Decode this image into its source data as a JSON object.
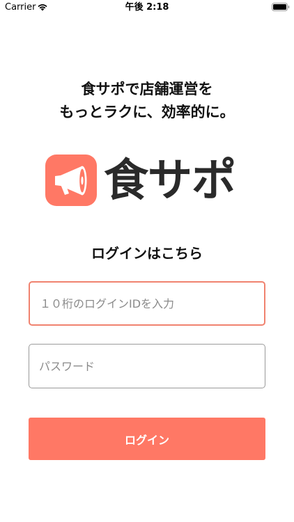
{
  "status_bar": {
    "carrier": "Carrier",
    "time": "午後 2:18"
  },
  "tagline": {
    "line1": "食サポで店舗運営を",
    "line2": "もっとラクに、効率的に。"
  },
  "logo": {
    "text": "食サポ",
    "icon": "megaphone-icon",
    "mark_color": "#ff7865"
  },
  "login": {
    "heading": "ログインはこちら",
    "id_placeholder": "１０桁のログインIDを入力",
    "password_placeholder": "パスワード",
    "button_label": "ログイン"
  },
  "colors": {
    "accent": "#ff7865",
    "focus_border": "#f0826f",
    "text": "#111111"
  }
}
